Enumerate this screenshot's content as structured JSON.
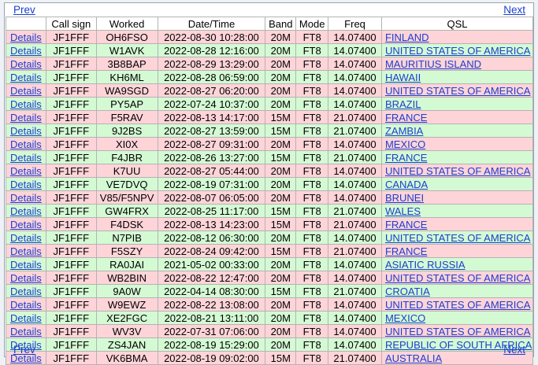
{
  "nav": {
    "prev_label": "Prev",
    "next_label": "Next"
  },
  "colors": {
    "row_pink": "#ffd4d8",
    "row_green": "#d4fad4",
    "link": "#1a3fcf"
  },
  "table": {
    "headers": [
      "",
      "Call sign",
      "Worked",
      "Date/Time",
      "Band",
      "Mode",
      "Freq",
      "QSL"
    ],
    "rows": [
      {
        "details": "Details",
        "call": "JF1FFF",
        "worked": "OH6FSO",
        "datetime": "2022-08-30 10:28:00",
        "band": "20M",
        "mode": "FT8",
        "freq": "14.07400",
        "qsl": "FINLAND",
        "shade": "pink"
      },
      {
        "details": "Details",
        "call": "JF1FFF",
        "worked": "W1AVK",
        "datetime": "2022-08-28 12:16:00",
        "band": "20M",
        "mode": "FT8",
        "freq": "14.07400",
        "qsl": "UNITED STATES OF AMERICA",
        "shade": "green"
      },
      {
        "details": "Details",
        "call": "JF1FFF",
        "worked": "3B8BAP",
        "datetime": "2022-08-29 13:29:00",
        "band": "20M",
        "mode": "FT8",
        "freq": "14.07400",
        "qsl": "MAURITIUS ISLAND",
        "shade": "pink"
      },
      {
        "details": "Details",
        "call": "JF1FFF",
        "worked": "KH6ML",
        "datetime": "2022-08-28 06:59:00",
        "band": "20M",
        "mode": "FT8",
        "freq": "14.07400",
        "qsl": "HAWAII",
        "shade": "green"
      },
      {
        "details": "Details",
        "call": "JF1FFF",
        "worked": "WA9SGD",
        "datetime": "2022-08-27 06:20:00",
        "band": "20M",
        "mode": "FT8",
        "freq": "14.07400",
        "qsl": "UNITED STATES OF AMERICA",
        "shade": "pink"
      },
      {
        "details": "Details",
        "call": "JF1FFF",
        "worked": "PY5AP",
        "datetime": "2022-07-24 10:37:00",
        "band": "20M",
        "mode": "FT8",
        "freq": "14.07400",
        "qsl": "BRAZIL",
        "shade": "green"
      },
      {
        "details": "Details",
        "call": "JF1FFF",
        "worked": "F5RAV",
        "datetime": "2022-08-13 14:17:00",
        "band": "15M",
        "mode": "FT8",
        "freq": "21.07400",
        "qsl": "FRANCE",
        "shade": "pink"
      },
      {
        "details": "Details",
        "call": "JF1FFF",
        "worked": "9J2BS",
        "datetime": "2022-08-27 13:59:00",
        "band": "15M",
        "mode": "FT8",
        "freq": "21.07400",
        "qsl": "ZAMBIA",
        "shade": "green"
      },
      {
        "details": "Details",
        "call": "JF1FFF",
        "worked": "XI0X",
        "datetime": "2022-08-27 09:31:00",
        "band": "20M",
        "mode": "FT8",
        "freq": "14.07400",
        "qsl": "MEXICO",
        "shade": "pink"
      },
      {
        "details": "Details",
        "call": "JF1FFF",
        "worked": "F4JBR",
        "datetime": "2022-08-26 13:27:00",
        "band": "15M",
        "mode": "FT8",
        "freq": "21.07400",
        "qsl": "FRANCE",
        "shade": "green"
      },
      {
        "details": "Details",
        "call": "JF1FFF",
        "worked": "K7UU",
        "datetime": "2022-08-27 05:44:00",
        "band": "20M",
        "mode": "FT8",
        "freq": "14.07400",
        "qsl": "UNITED STATES OF AMERICA",
        "shade": "pink"
      },
      {
        "details": "Details",
        "call": "JF1FFF",
        "worked": "VE7DVQ",
        "datetime": "2022-08-19 07:31:00",
        "band": "20M",
        "mode": "FT8",
        "freq": "14.07400",
        "qsl": "CANADA",
        "shade": "green"
      },
      {
        "details": "Details",
        "call": "JF1FFF",
        "worked": "V85/F5NPV",
        "datetime": "2022-08-07 06:05:00",
        "band": "20M",
        "mode": "FT8",
        "freq": "14.07400",
        "qsl": "BRUNEI",
        "shade": "pink"
      },
      {
        "details": "Details",
        "call": "JF1FFF",
        "worked": "GW4FRX",
        "datetime": "2022-08-25 11:17:00",
        "band": "15M",
        "mode": "FT8",
        "freq": "21.07400",
        "qsl": "WALES",
        "shade": "green"
      },
      {
        "details": "Details",
        "call": "JF1FFF",
        "worked": "F4DSK",
        "datetime": "2022-08-13 14:23:00",
        "band": "15M",
        "mode": "FT8",
        "freq": "21.07400",
        "qsl": "FRANCE",
        "shade": "pink"
      },
      {
        "details": "Details",
        "call": "JF1FFF",
        "worked": "N7PIB",
        "datetime": "2022-08-12 06:30:00",
        "band": "20M",
        "mode": "FT8",
        "freq": "14.07400",
        "qsl": "UNITED STATES OF AMERICA",
        "shade": "green"
      },
      {
        "details": "Details",
        "call": "JF1FFF",
        "worked": "F5SZY",
        "datetime": "2022-08-24 09:42:00",
        "band": "15M",
        "mode": "FT8",
        "freq": "21.07400",
        "qsl": "FRANCE",
        "shade": "pink"
      },
      {
        "details": "Details",
        "call": "JF1FFF",
        "worked": "RA0JAI",
        "datetime": "2021-05-02 00:33:00",
        "band": "20M",
        "mode": "FT8",
        "freq": "14.07400",
        "qsl": "ASIATIC RUSSIA",
        "shade": "green"
      },
      {
        "details": "Details",
        "call": "JF1FFF",
        "worked": "WB2BIN",
        "datetime": "2022-08-22 12:47:00",
        "band": "20M",
        "mode": "FT8",
        "freq": "14.07400",
        "qsl": "UNITED STATES OF AMERICA",
        "shade": "pink"
      },
      {
        "details": "Details",
        "call": "JF1FFF",
        "worked": "9A0W",
        "datetime": "2022-04-14 08:30:00",
        "band": "15M",
        "mode": "FT8",
        "freq": "21.07400",
        "qsl": "CROATIA",
        "shade": "green"
      },
      {
        "details": "Details",
        "call": "JF1FFF",
        "worked": "W9EWZ",
        "datetime": "2022-08-22 13:08:00",
        "band": "20M",
        "mode": "FT8",
        "freq": "14.07400",
        "qsl": "UNITED STATES OF AMERICA",
        "shade": "pink"
      },
      {
        "details": "Details",
        "call": "JF1FFF",
        "worked": "XE2FGC",
        "datetime": "2022-08-21 13:11:00",
        "band": "20M",
        "mode": "FT8",
        "freq": "14.07400",
        "qsl": "MEXICO",
        "shade": "green"
      },
      {
        "details": "Details",
        "call": "JF1FFF",
        "worked": "WV3V",
        "datetime": "2022-07-31 07:06:00",
        "band": "20M",
        "mode": "FT8",
        "freq": "14.07400",
        "qsl": "UNITED STATES OF AMERICA",
        "shade": "pink"
      },
      {
        "details": "Details",
        "call": "JF1FFF",
        "worked": "ZS4JAN",
        "datetime": "2022-08-19 15:29:00",
        "band": "20M",
        "mode": "FT8",
        "freq": "14.07400",
        "qsl": "REPUBLIC OF SOUTH AFRICA",
        "shade": "green"
      },
      {
        "details": "Details",
        "call": "JF1FFF",
        "worked": "VK6BMA",
        "datetime": "2022-08-19 09:02:00",
        "band": "15M",
        "mode": "FT8",
        "freq": "21.07400",
        "qsl": "AUSTRALIA",
        "shade": "pink"
      }
    ]
  }
}
